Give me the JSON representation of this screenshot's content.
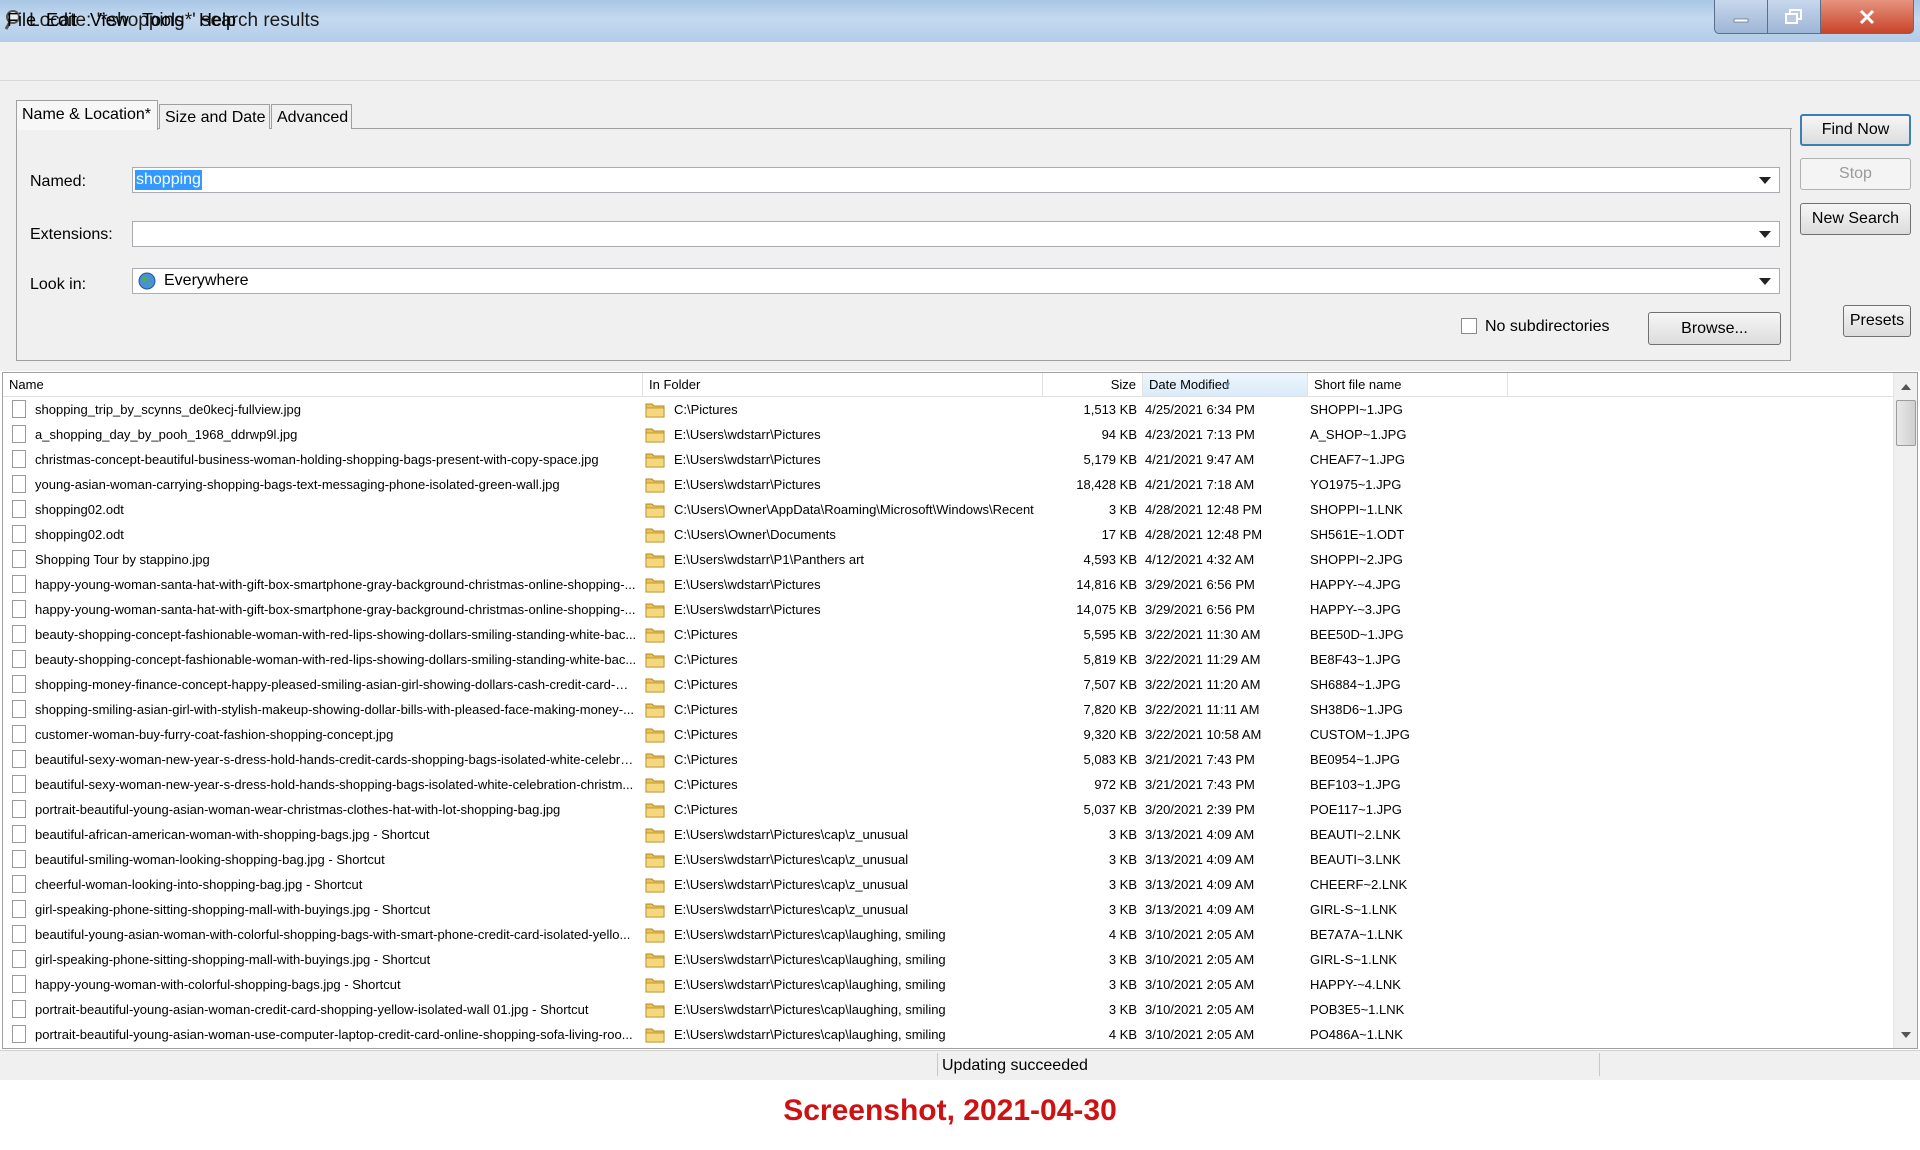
{
  "window": {
    "title": "Locate: '*shopping*' search results"
  },
  "menu": [
    "File",
    "Edit",
    "View",
    "Tools",
    "Help"
  ],
  "tabs": [
    "Name & Location*",
    "Size and Date",
    "Advanced"
  ],
  "form": {
    "named_label": "Named:",
    "named_value": "shopping",
    "extensions_label": "Extensions:",
    "extensions_value": "",
    "lookin_label": "Look in:",
    "lookin_value": "Everywhere",
    "no_subdirs_label": "No subdirectories",
    "browse_label": "Browse..."
  },
  "side_buttons": {
    "find_now": "Find Now",
    "stop": "Stop",
    "new_search": "New Search",
    "presets": "Presets"
  },
  "columns": [
    "Name",
    "In Folder",
    "Size",
    "Date Modified",
    "Short file name"
  ],
  "rows": [
    {
      "name": "shopping_trip_by_scynns_de0kecj-fullview.jpg",
      "folder": "C:\\Pictures",
      "size": "1,513 KB",
      "date": "4/25/2021 6:34 PM",
      "short": "SHOPPI~1.JPG"
    },
    {
      "name": "a_shopping_day_by_pooh_1968_ddrwp9l.jpg",
      "folder": "E:\\Users\\wdstarr\\Pictures",
      "size": "94 KB",
      "date": "4/23/2021 7:13 PM",
      "short": "A_SHOP~1.JPG"
    },
    {
      "name": "christmas-concept-beautiful-business-woman-holding-shopping-bags-present-with-copy-space.jpg",
      "folder": "E:\\Users\\wdstarr\\Pictures",
      "size": "5,179 KB",
      "date": "4/21/2021 9:47 AM",
      "short": "CHEAF7~1.JPG"
    },
    {
      "name": "young-asian-woman-carrying-shopping-bags-text-messaging-phone-isolated-green-wall.jpg",
      "folder": "E:\\Users\\wdstarr\\Pictures",
      "size": "18,428 KB",
      "date": "4/21/2021 7:18 AM",
      "short": "YO1975~1.JPG"
    },
    {
      "name": "shopping02.odt",
      "folder": "C:\\Users\\Owner\\AppData\\Roaming\\Microsoft\\Windows\\Recent",
      "size": "3 KB",
      "date": "4/28/2021 12:48 PM",
      "short": "SHOPPI~1.LNK"
    },
    {
      "name": "shopping02.odt",
      "folder": "C:\\Users\\Owner\\Documents",
      "size": "17 KB",
      "date": "4/28/2021 12:48 PM",
      "short": "SH561E~1.ODT"
    },
    {
      "name": "Shopping Tour by stappino.jpg",
      "folder": "E:\\Users\\wdstarr\\P1\\Panthers art",
      "size": "4,593 KB",
      "date": "4/12/2021 4:32 AM",
      "short": "SHOPPI~2.JPG"
    },
    {
      "name": "happy-young-woman-santa-hat-with-gift-box-smartphone-gray-background-christmas-online-shopping-...",
      "folder": "E:\\Users\\wdstarr\\Pictures",
      "size": "14,816 KB",
      "date": "3/29/2021 6:56 PM",
      "short": "HAPPY-~4.JPG"
    },
    {
      "name": "happy-young-woman-santa-hat-with-gift-box-smartphone-gray-background-christmas-online-shopping-...",
      "folder": "E:\\Users\\wdstarr\\Pictures",
      "size": "14,075 KB",
      "date": "3/29/2021 6:56 PM",
      "short": "HAPPY-~3.JPG"
    },
    {
      "name": "beauty-shopping-concept-fashionable-woman-with-red-lips-showing-dollars-smiling-standing-white-bac...",
      "folder": "C:\\Pictures",
      "size": "5,595 KB",
      "date": "3/22/2021 11:30 AM",
      "short": "BEE50D~1.JPG"
    },
    {
      "name": "beauty-shopping-concept-fashionable-woman-with-red-lips-showing-dollars-smiling-standing-white-bac...",
      "folder": "C:\\Pictures",
      "size": "5,819 KB",
      "date": "3/22/2021 11:29 AM",
      "short": "BE8F43~1.JPG"
    },
    {
      "name": "shopping-money-finance-concept-happy-pleased-smiling-asian-girl-showing-dollars-cash-credit-card-wi...",
      "folder": "C:\\Pictures",
      "size": "7,507 KB",
      "date": "3/22/2021 11:20 AM",
      "short": "SH6884~1.JPG"
    },
    {
      "name": "shopping-smiling-asian-girl-with-stylish-makeup-showing-dollar-bills-with-pleased-face-making-money-...",
      "folder": "C:\\Pictures",
      "size": "7,820 KB",
      "date": "3/22/2021 11:11 AM",
      "short": "SH38D6~1.JPG"
    },
    {
      "name": "customer-woman-buy-furry-coat-fashion-shopping-concept.jpg",
      "folder": "C:\\Pictures",
      "size": "9,320 KB",
      "date": "3/22/2021 10:58 AM",
      "short": "CUSTOM~1.JPG"
    },
    {
      "name": "beautiful-sexy-woman-new-year-s-dress-hold-hands-credit-cards-shopping-bags-isolated-white-celebra...",
      "folder": "C:\\Pictures",
      "size": "5,083 KB",
      "date": "3/21/2021 7:43 PM",
      "short": "BE0954~1.JPG"
    },
    {
      "name": "beautiful-sexy-woman-new-year-s-dress-hold-hands-shopping-bags-isolated-white-celebration-christm...",
      "folder": "C:\\Pictures",
      "size": "972 KB",
      "date": "3/21/2021 7:43 PM",
      "short": "BEF103~1.JPG"
    },
    {
      "name": "portrait-beautiful-young-asian-woman-wear-christmas-clothes-hat-with-lot-shopping-bag.jpg",
      "folder": "C:\\Pictures",
      "size": "5,037 KB",
      "date": "3/20/2021 2:39 PM",
      "short": "POE117~1.JPG"
    },
    {
      "name": "beautiful-african-american-woman-with-shopping-bags.jpg - Shortcut",
      "folder": "E:\\Users\\wdstarr\\Pictures\\cap\\z_unusual",
      "size": "3 KB",
      "date": "3/13/2021 4:09 AM",
      "short": "BEAUTI~2.LNK"
    },
    {
      "name": "beautiful-smiling-woman-looking-shopping-bag.jpg - Shortcut",
      "folder": "E:\\Users\\wdstarr\\Pictures\\cap\\z_unusual",
      "size": "3 KB",
      "date": "3/13/2021 4:09 AM",
      "short": "BEAUTI~3.LNK"
    },
    {
      "name": "cheerful-woman-looking-into-shopping-bag.jpg - Shortcut",
      "folder": "E:\\Users\\wdstarr\\Pictures\\cap\\z_unusual",
      "size": "3 KB",
      "date": "3/13/2021 4:09 AM",
      "short": "CHEERF~2.LNK"
    },
    {
      "name": "girl-speaking-phone-sitting-shopping-mall-with-buyings.jpg - Shortcut",
      "folder": "E:\\Users\\wdstarr\\Pictures\\cap\\z_unusual",
      "size": "3 KB",
      "date": "3/13/2021 4:09 AM",
      "short": "GIRL-S~1.LNK"
    },
    {
      "name": "beautiful-young-asian-woman-with-colorful-shopping-bags-with-smart-phone-credit-card-isolated-yello...",
      "folder": "E:\\Users\\wdstarr\\Pictures\\cap\\laughing, smiling",
      "size": "4 KB",
      "date": "3/10/2021 2:05 AM",
      "short": "BE7A7A~1.LNK"
    },
    {
      "name": "girl-speaking-phone-sitting-shopping-mall-with-buyings.jpg - Shortcut",
      "folder": "E:\\Users\\wdstarr\\Pictures\\cap\\laughing, smiling",
      "size": "3 KB",
      "date": "3/10/2021 2:05 AM",
      "short": "GIRL-S~1.LNK"
    },
    {
      "name": "happy-young-woman-with-colorful-shopping-bags.jpg - Shortcut",
      "folder": "E:\\Users\\wdstarr\\Pictures\\cap\\laughing, smiling",
      "size": "3 KB",
      "date": "3/10/2021 2:05 AM",
      "short": "HAPPY-~4.LNK"
    },
    {
      "name": "portrait-beautiful-young-asian-woman-credit-card-shopping-yellow-isolated-wall 01.jpg - Shortcut",
      "folder": "E:\\Users\\wdstarr\\Pictures\\cap\\laughing, smiling",
      "size": "3 KB",
      "date": "3/10/2021 2:05 AM",
      "short": "POB3E5~1.LNK"
    },
    {
      "name": "portrait-beautiful-young-asian-woman-use-computer-laptop-credit-card-online-shopping-sofa-living-roo...",
      "folder": "E:\\Users\\wdstarr\\Pictures\\cap\\laughing, smiling",
      "size": "4 KB",
      "date": "3/10/2021 2:05 AM",
      "short": "PO486A~1.LNK"
    }
  ],
  "status": "Updating succeeded",
  "caption": "Screenshot, 2021-04-30",
  "colors": {
    "caption": "#cc1212",
    "selection": "#3399ff",
    "titlebar": "#b4cce8"
  },
  "icons": {
    "file": "file-icon",
    "folder": "folder-icon",
    "globe": "globe-icon"
  }
}
